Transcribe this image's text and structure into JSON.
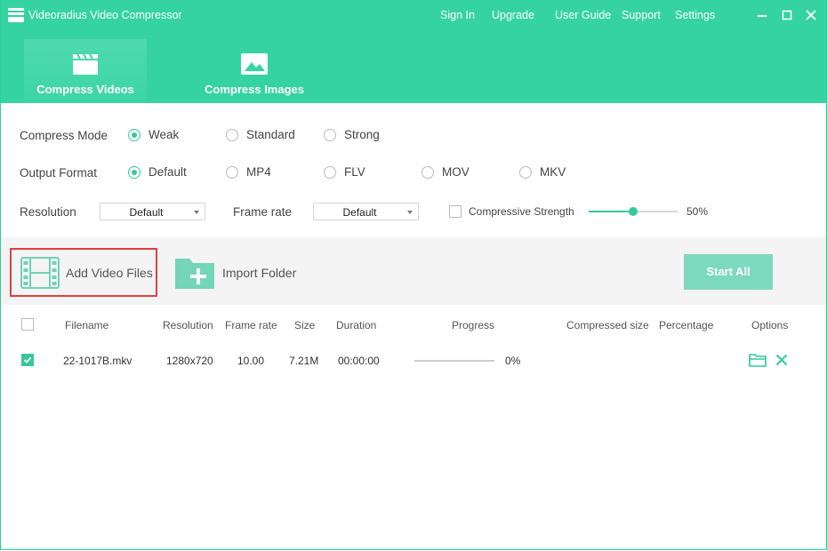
{
  "app": {
    "title": "Videoradius Video Compressor"
  },
  "topnav": {
    "sign_in": "Sign In",
    "upgrade": "Upgrade",
    "user_guide": "User Guide",
    "support": "Support",
    "settings": "Settings"
  },
  "tabs": [
    {
      "label": "Compress Videos",
      "icon": "clapperboard-icon",
      "active": true
    },
    {
      "label": "Compress Images",
      "icon": "image-icon",
      "active": false
    }
  ],
  "settings": {
    "compress_mode": {
      "label": "Compress Mode",
      "options": [
        "Weak",
        "Standard",
        "Strong"
      ],
      "selected": "Weak"
    },
    "output_format": {
      "label": "Output Format",
      "options": [
        "Default",
        "MP4",
        "FLV",
        "MOV",
        "MKV"
      ],
      "selected": "Default"
    },
    "resolution": {
      "label": "Resolution",
      "value": "Default"
    },
    "frame_rate": {
      "label": "Frame rate",
      "value": "Default"
    },
    "compressive_strength": {
      "label": "Compressive Strength",
      "checked": false,
      "value": "50%",
      "fraction": 0.5
    }
  },
  "toolbar": {
    "add_video_files": "Add Video Files",
    "import_folder": "Import Folder",
    "start_all": "Start All"
  },
  "table": {
    "headers": {
      "filename": "Filename",
      "resolution": "Resolution",
      "frame_rate": "Frame rate",
      "size": "Size",
      "duration": "Duration",
      "progress": "Progress",
      "compressed_size": "Compressed size",
      "percentage": "Percentage",
      "options": "Options"
    },
    "rows": [
      {
        "checked": true,
        "filename": "22-1017B.mkv",
        "resolution": "1280x720",
        "frame_rate": "10.00",
        "size": "7.21M",
        "duration": "00:00:00",
        "progress": "0%",
        "progress_fraction": 0,
        "compressed_size": "",
        "percentage": ""
      }
    ]
  },
  "colors": {
    "accent": "#35d3a0",
    "button": "#7dd9bd",
    "highlight": "#e04040"
  }
}
